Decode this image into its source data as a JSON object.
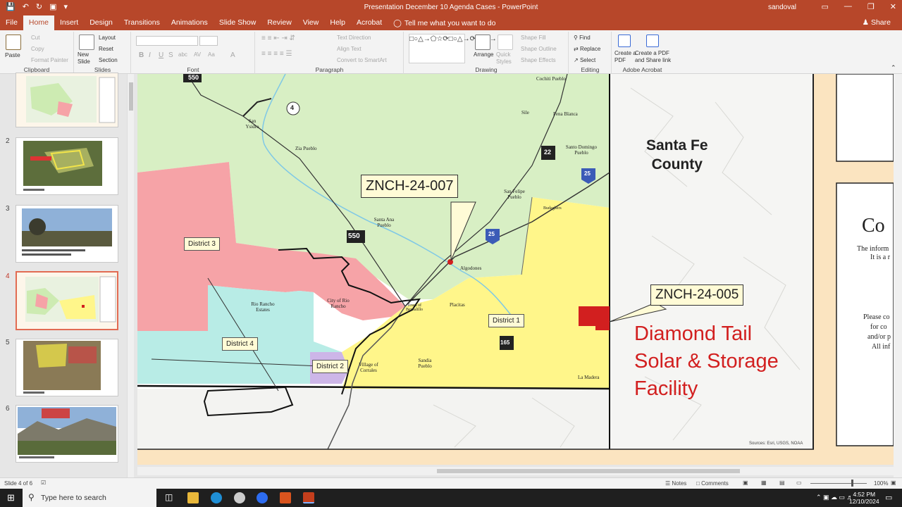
{
  "window": {
    "title": "Presentation December 10 Agenda Cases  -  PowerPoint",
    "user": "sandoval"
  },
  "menu": {
    "tabs": [
      "File",
      "Home",
      "Insert",
      "Design",
      "Transitions",
      "Animations",
      "Slide Show",
      "Review",
      "View",
      "Help",
      "Acrobat"
    ],
    "active": "Home",
    "tell_me": "Tell me what you want to do",
    "share": "Share"
  },
  "ribbon": {
    "clipboard": {
      "name": "Clipboard",
      "paste": "Paste",
      "cut": "Cut",
      "copy": "Copy",
      "format_painter": "Format Painter"
    },
    "slides": {
      "name": "Slides",
      "new_slide": "New Slide",
      "layout": "Layout",
      "reset": "Reset",
      "section": "Section"
    },
    "font": {
      "name": "Font",
      "bold": "B",
      "italic": "I",
      "underline": "U",
      "strike": "S",
      "abc": "abc",
      "av": "AV",
      "aa": "Aa",
      "a": "A"
    },
    "paragraph": {
      "name": "Paragraph",
      "text_direction": "Text Direction",
      "align_text": "Align Text",
      "convert": "Convert to SmartArt"
    },
    "drawing": {
      "name": "Drawing",
      "arrange": "Arrange",
      "quick_styles": "Quick Styles",
      "shape_fill": "Shape Fill",
      "shape_outline": "Shape Outline",
      "shape_effects": "Shape Effects"
    },
    "editing": {
      "name": "Editing",
      "find": "Find",
      "replace": "Replace",
      "select": "Select"
    },
    "acrobat": {
      "name": "Adobe Acrobat",
      "create_pdf": "Create a PDF",
      "create_share": "Create a PDF and Share link"
    }
  },
  "thumbnails": [
    {
      "num": "",
      "selected": false
    },
    {
      "num": "2",
      "selected": false
    },
    {
      "num": "3",
      "selected": false
    },
    {
      "num": "4",
      "selected": true
    },
    {
      "num": "5",
      "selected": false
    },
    {
      "num": "6",
      "selected": false
    }
  ],
  "slide": {
    "county": "Santa Fe County",
    "county_line1": "Santa Fe",
    "county_line2": "County",
    "case1": "ZNCH-24-007",
    "case2": "ZNCH-24-005",
    "facility_line1": "Diamond Tail",
    "facility_line2": "Solar & Storage",
    "facility_line3": "Facility",
    "district1": "District 1",
    "district2": "District 2",
    "district3": "District 3",
    "district4": "District 4",
    "places": {
      "cochiti": "Cochiti Pueblo",
      "sile": "Sile",
      "pena_blanca": "Pena Blanca",
      "santo_domingo": "Santo Domingo Pueblo",
      "san_ysidro": "San Ysidro",
      "zia": "Zia Pueblo",
      "san_felipe": "San Felipe Pueblo",
      "santa_ana": "Santa Ana Pueblo",
      "algodones": "Algodones",
      "rio_rancho_estates": "Rio Rancho Estates",
      "city_rio_rancho": "City of Rio Rancho",
      "placitas": "Placitas",
      "bernalillo": "Town of Bernalillo",
      "sandia": "Sandia Pueblo",
      "corrales": "Village of Corrales",
      "la_madera": "La Madera",
      "budaghers": "Budaghers"
    },
    "shields": {
      "r1": "4",
      "r2": "22",
      "r3": "550",
      "r4": "25",
      "r5": "25",
      "r6": "165",
      "r7": "550"
    },
    "source": "Sources: Esri, USGS, NOAA",
    "side_card": {
      "title": "Co",
      "line1": "The inform",
      "line2": "It is a r",
      "p1": "Please co",
      "p2": "for co",
      "p3": "and/or p",
      "p4": "All inf"
    }
  },
  "status": {
    "slide": "Slide 4 of 6",
    "notes": "Notes",
    "comments": "Comments",
    "zoom": "100%"
  },
  "taskbar": {
    "search": "Type here to search",
    "time": "4:52 PM",
    "date": "12/10/2024"
  },
  "colors": {
    "accent": "#b7472a",
    "district_yellow": "#fff68a",
    "district_pink": "#f6a3a7",
    "district_green": "#cdebb2",
    "district_cyan": "#b8ece6",
    "district_purple": "#cdb6e8",
    "facility_red": "#d21f1f"
  }
}
